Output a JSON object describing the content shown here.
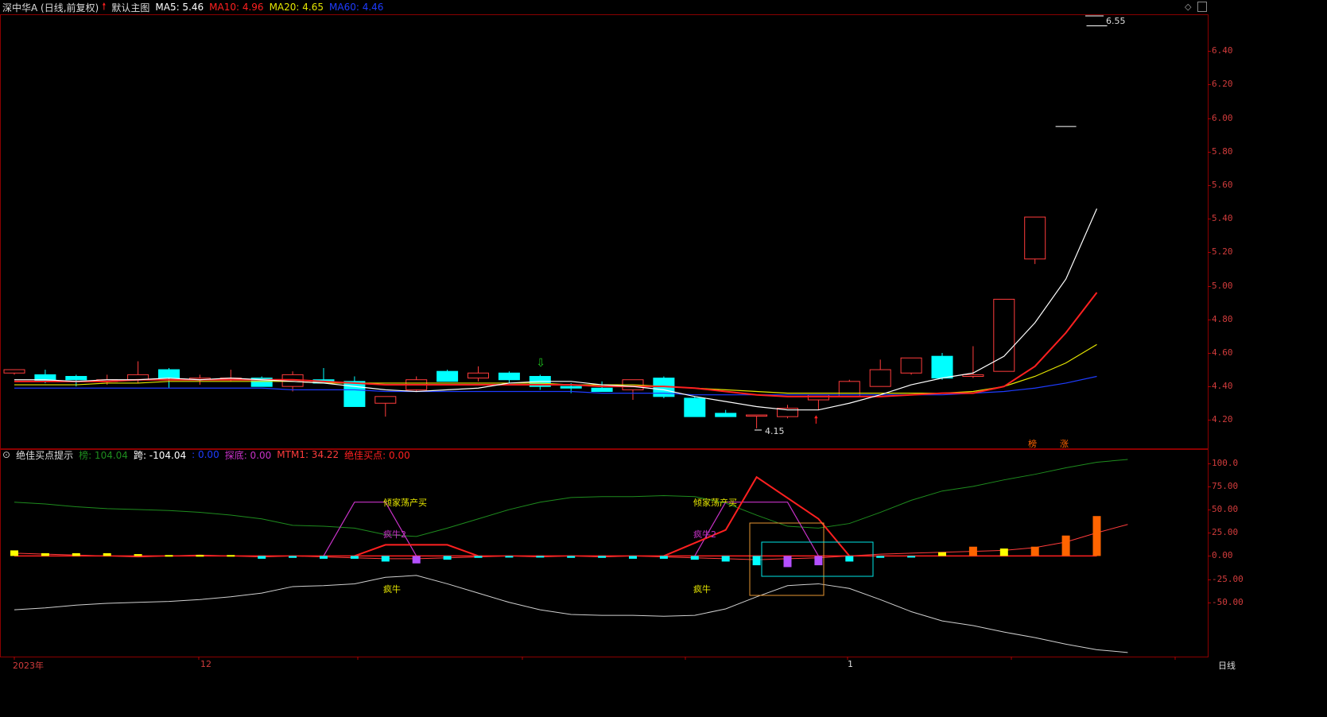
{
  "main_header": {
    "title": "深中华A (日线,前复权)",
    "template": "默认主图",
    "ma5": "MA5: 5.46",
    "ma10": "MA10: 4.96",
    "ma20": "MA20: 4.65",
    "ma60": "MA60: 4.46"
  },
  "ind_header": {
    "name": "绝佳买点提示",
    "bang": "榜: 104.04",
    "kua": "跨: -104.04",
    "blank": ": 0.00",
    "tandi": "探底: 0.00",
    "mtm1": "MTM1: 34.22",
    "buy": "绝佳买点: 0.00"
  },
  "price_axis": [
    "6.40",
    "6.20",
    "6.00",
    "5.80",
    "5.60",
    "5.40",
    "5.20",
    "5.00",
    "4.80",
    "4.60",
    "4.40",
    "4.20"
  ],
  "ind_axis": [
    "100.0",
    "75.00",
    "50.00",
    "25.00",
    "0.00",
    "-25.00",
    "-50.00"
  ],
  "x_axis": {
    "year": "2023年",
    "dec": "12",
    "jan": "1",
    "period": "日线"
  },
  "annotations": {
    "high": "6.55",
    "low": "4.15",
    "bang_tag": "榜",
    "zhang_tag": "涨",
    "qjdcm1": "倾家荡产买",
    "qjdcm2": "倾家荡产买",
    "fn2a": "疯牛2",
    "fn2b": "疯牛2",
    "fn1": "疯牛",
    "fn2": "疯牛"
  },
  "colors": {
    "up": "#ff3c3c",
    "down": "#00ffff",
    "ma5": "#ffffff",
    "ma10": "#ff2020",
    "ma20": "#e6e600",
    "ma60": "#1e3cff",
    "bang": "#1e8c1e",
    "purple": "#c832c8",
    "orange": "#ff6400"
  },
  "chart_data": {
    "type": "candlestick",
    "price_range": [
      4.05,
      6.6
    ],
    "candles": [
      {
        "o": 4.48,
        "h": 4.49,
        "l": 4.47,
        "c": 4.5
      },
      {
        "o": 4.47,
        "h": 4.5,
        "l": 4.42,
        "c": 4.43
      },
      {
        "o": 4.46,
        "h": 4.47,
        "l": 4.4,
        "c": 4.44
      },
      {
        "o": 4.43,
        "h": 4.47,
        "l": 4.41,
        "c": 4.44
      },
      {
        "o": 4.44,
        "h": 4.55,
        "l": 4.42,
        "c": 4.47
      },
      {
        "o": 4.5,
        "h": 4.51,
        "l": 4.39,
        "c": 4.45
      },
      {
        "o": 4.44,
        "h": 4.47,
        "l": 4.41,
        "c": 4.45
      },
      {
        "o": 4.45,
        "h": 4.5,
        "l": 4.43,
        "c": 4.45
      },
      {
        "o": 4.45,
        "h": 4.46,
        "l": 4.4,
        "c": 4.4
      },
      {
        "o": 4.4,
        "h": 4.49,
        "l": 4.37,
        "c": 4.47
      },
      {
        "o": 4.44,
        "h": 4.51,
        "l": 4.42,
        "c": 4.42
      },
      {
        "o": 4.43,
        "h": 4.46,
        "l": 4.28,
        "c": 4.28
      },
      {
        "o": 4.3,
        "h": 4.34,
        "l": 4.22,
        "c": 4.34
      },
      {
        "o": 4.38,
        "h": 4.46,
        "l": 4.37,
        "c": 4.44
      },
      {
        "o": 4.49,
        "h": 4.5,
        "l": 4.43,
        "c": 4.43
      },
      {
        "o": 4.45,
        "h": 4.52,
        "l": 4.43,
        "c": 4.48
      },
      {
        "o": 4.48,
        "h": 4.49,
        "l": 4.42,
        "c": 4.44
      },
      {
        "o": 4.46,
        "h": 4.47,
        "l": 4.38,
        "c": 4.4
      },
      {
        "o": 4.4,
        "h": 4.42,
        "l": 4.36,
        "c": 4.39
      },
      {
        "o": 4.39,
        "h": 4.43,
        "l": 4.37,
        "c": 4.37
      },
      {
        "o": 4.38,
        "h": 4.44,
        "l": 4.32,
        "c": 4.44
      },
      {
        "o": 4.45,
        "h": 4.46,
        "l": 4.33,
        "c": 4.34
      },
      {
        "o": 4.33,
        "h": 4.34,
        "l": 4.22,
        "c": 4.22
      },
      {
        "o": 4.24,
        "h": 4.26,
        "l": 4.22,
        "c": 4.22
      },
      {
        "o": 4.23,
        "h": 4.23,
        "l": 4.15,
        "c": 4.23
      },
      {
        "o": 4.22,
        "h": 4.29,
        "l": 4.21,
        "c": 4.27
      },
      {
        "o": 4.32,
        "h": 4.35,
        "l": 4.26,
        "c": 4.35
      },
      {
        "o": 4.34,
        "h": 4.44,
        "l": 4.34,
        "c": 4.43
      },
      {
        "o": 4.4,
        "h": 4.56,
        "l": 4.4,
        "c": 4.5
      },
      {
        "o": 4.48,
        "h": 4.57,
        "l": 4.47,
        "c": 4.57
      },
      {
        "o": 4.58,
        "h": 4.6,
        "l": 4.44,
        "c": 4.45
      },
      {
        "o": 4.46,
        "h": 4.64,
        "l": 4.45,
        "c": 4.47
      },
      {
        "o": 4.49,
        "h": 4.92,
        "l": 4.49,
        "c": 4.92
      },
      {
        "o": 5.16,
        "h": 5.41,
        "l": 5.13,
        "c": 5.41
      },
      {
        "o": 5.95,
        "h": 5.95,
        "l": 5.95,
        "c": 5.95
      },
      {
        "o": 6.55,
        "h": 6.55,
        "l": 6.55,
        "c": 6.55
      }
    ],
    "ma5": [
      4.44,
      4.44,
      4.43,
      4.44,
      4.44,
      4.45,
      4.44,
      4.45,
      4.44,
      4.43,
      4.42,
      4.4,
      4.38,
      4.37,
      4.38,
      4.39,
      4.42,
      4.43,
      4.43,
      4.41,
      4.4,
      4.38,
      4.34,
      4.31,
      4.28,
      4.26,
      4.26,
      4.3,
      4.35,
      4.41,
      4.45,
      4.48,
      4.58,
      4.78,
      5.04,
      5.46
    ],
    "ma10": [
      4.43,
      4.43,
      4.43,
      4.43,
      4.44,
      4.44,
      4.44,
      4.44,
      4.44,
      4.44,
      4.43,
      4.42,
      4.41,
      4.41,
      4.41,
      4.41,
      4.41,
      4.41,
      4.41,
      4.4,
      4.4,
      4.4,
      4.39,
      4.37,
      4.35,
      4.34,
      4.34,
      4.34,
      4.34,
      4.35,
      4.36,
      4.36,
      4.4,
      4.52,
      4.72,
      4.96
    ],
    "ma20": [
      4.41,
      4.41,
      4.41,
      4.42,
      4.42,
      4.43,
      4.43,
      4.43,
      4.43,
      4.43,
      4.42,
      4.42,
      4.42,
      4.42,
      4.42,
      4.42,
      4.42,
      4.42,
      4.41,
      4.41,
      4.41,
      4.4,
      4.39,
      4.38,
      4.37,
      4.36,
      4.36,
      4.36,
      4.36,
      4.36,
      4.36,
      4.37,
      4.4,
      4.46,
      4.54,
      4.65
    ],
    "ma60": [
      4.39,
      4.39,
      4.39,
      4.39,
      4.39,
      4.39,
      4.39,
      4.39,
      4.39,
      4.38,
      4.38,
      4.38,
      4.37,
      4.37,
      4.37,
      4.37,
      4.37,
      4.37,
      4.37,
      4.36,
      4.36,
      4.36,
      4.35,
      4.35,
      4.35,
      4.35,
      4.35,
      4.35,
      4.35,
      4.35,
      4.35,
      4.36,
      4.37,
      4.39,
      4.42,
      4.46
    ],
    "indicator": {
      "range": [
        -105,
        110
      ],
      "bang": [
        58,
        56,
        53,
        51,
        50,
        49,
        47,
        44,
        40,
        33,
        32,
        30,
        23,
        21,
        30,
        40,
        50,
        58,
        63,
        64,
        64,
        65,
        64,
        57,
        44,
        32,
        30,
        35,
        47,
        60,
        70,
        75,
        82,
        88,
        95,
        101,
        104
      ],
      "kua": [
        -58,
        -56,
        -53,
        -51,
        -50,
        -49,
        -47,
        -44,
        -40,
        -33,
        -32,
        -30,
        -23,
        -21,
        -30,
        -40,
        -50,
        -58,
        -63,
        -64,
        -64,
        -65,
        -64,
        -57,
        -44,
        -32,
        -30,
        -35,
        -47,
        -60,
        -70,
        -75,
        -82,
        -88,
        -95,
        -101,
        -104
      ],
      "mtm1": [
        3,
        2,
        1,
        0,
        -1,
        0,
        1,
        0,
        -1,
        0,
        -1,
        -2,
        -3,
        -3,
        -2,
        -1,
        0,
        -1,
        0,
        -1,
        0,
        -1,
        -2,
        -3,
        -4,
        -3,
        -2,
        0,
        2,
        3,
        4,
        5,
        6,
        9,
        15,
        25,
        34
      ],
      "bars": [
        6,
        3,
        3,
        3,
        2,
        1,
        1,
        1,
        -3,
        -2,
        -3,
        -3,
        -6,
        -8,
        -4,
        -2,
        -1,
        -1,
        -2,
        -2,
        -3,
        -3,
        -4,
        -6,
        -10,
        -12,
        -10,
        -6,
        -2,
        -1,
        4,
        10,
        8,
        10,
        22,
        43,
        70,
        100
      ]
    }
  }
}
